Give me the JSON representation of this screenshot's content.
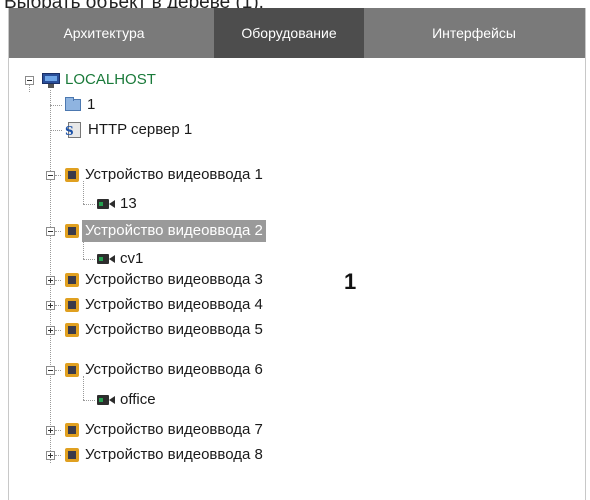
{
  "caption": "Выбрать объект в дереве (1).",
  "tabs": [
    {
      "label": "Архитектура"
    },
    {
      "label": "Оборудование"
    },
    {
      "label": "Интерфейсы"
    }
  ],
  "tree": {
    "root": "LOCALHOST",
    "folder": "1",
    "http": "HTTP сервер 1",
    "dev1": "Устройство видеоввода 1",
    "cam1": "13",
    "dev2": "Устройство видеоввода 2",
    "cam2": "cv1",
    "dev3": "Устройство видеоввода 3",
    "dev4": "Устройство видеоввода 4",
    "dev5": "Устройство видеоввода 5",
    "dev6": "Устройство видеоввода 6",
    "cam6": "office",
    "dev7": "Устройство видеоввода 7",
    "dev8": "Устройство видеоввода 8"
  },
  "selected_item": "Устройство видеоввода 2",
  "marker": "1",
  "colors": {
    "tab_bar": "#7a7a7a",
    "tab_active": "#4d4d4d",
    "selection": "#9a9a9a",
    "host_text": "#1a7a3a"
  }
}
